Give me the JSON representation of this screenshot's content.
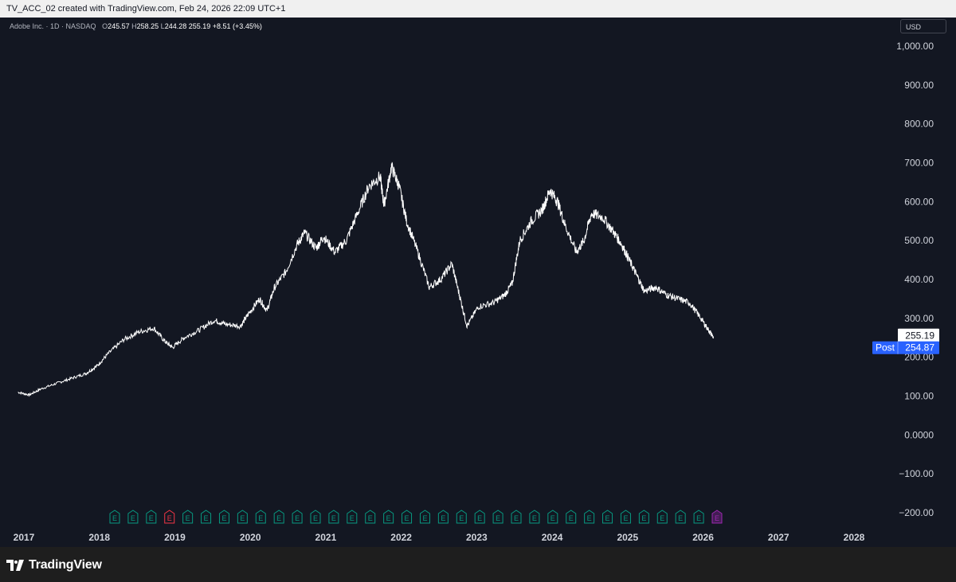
{
  "header": {
    "caption": "TV_ACC_02 created with TradingView.com, Feb 24, 2026 22:09 UTC+1"
  },
  "legend": {
    "symbol": "Adobe Inc. · 1D · NASDAQ",
    "open_label": "O",
    "open": "245.57",
    "high_label": "H",
    "high": "258.25",
    "low_label": "L",
    "low": "244.28",
    "close": "255.19",
    "change": "+8.51 (+3.45%)"
  },
  "currency_button": "USD",
  "price_badges": {
    "last": "255.19",
    "post_label": "Post",
    "post": "254.87"
  },
  "earnings": {
    "marker_label": "E",
    "count": 34,
    "last_color": "#9c27b0",
    "past_color": "#089981",
    "miss_color": "#f23645",
    "miss_index": 3
  },
  "brand": {
    "name": "TradingView",
    "icon": "tradingview-logo-icon"
  },
  "colors": {
    "background": "#131722",
    "line": "#ffffff",
    "axis_text": "#d1d4dc",
    "post_badge": "#2962ff"
  },
  "chart_data": {
    "type": "line",
    "title": "Adobe Inc. · 1D · NASDAQ",
    "xlabel": "",
    "ylabel": "",
    "x_ticks": [
      "2017",
      "2018",
      "2019",
      "2020",
      "2021",
      "2022",
      "2023",
      "2024",
      "2025",
      "2026",
      "2027",
      "2028"
    ],
    "y_ticks": [
      "1,000.00",
      "900.00",
      "800.00",
      "700.00",
      "600.00",
      "500.00",
      "400.00",
      "300.00",
      "200.00",
      "100.00",
      "0.0000",
      "−100.00",
      "−200.00"
    ],
    "ylim": [
      -200,
      1000
    ],
    "xlim": [
      2017.0,
      2028.0
    ],
    "series": [
      {
        "x": [
          2016.9,
          2017.05,
          2017.2,
          2017.4,
          2017.6,
          2017.8,
          2017.95,
          2018.1,
          2018.3,
          2018.5,
          2018.7,
          2018.85,
          2018.95,
          2019.1,
          2019.3,
          2019.5,
          2019.65,
          2019.85,
          2019.95,
          2020.1,
          2020.2,
          2020.3,
          2020.45,
          2020.6,
          2020.7,
          2020.85,
          2020.95,
          2021.1,
          2021.25,
          2021.4,
          2021.55,
          2021.7,
          2021.75,
          2021.85,
          2021.95,
          2022.05,
          2022.2,
          2022.35,
          2022.5,
          2022.65,
          2022.75,
          2022.85,
          2023.0,
          2023.2,
          2023.35,
          2023.45,
          2023.55,
          2023.7,
          2023.85,
          2023.95,
          2024.05,
          2024.15,
          2024.3,
          2024.4,
          2024.5,
          2024.65,
          2024.8,
          2024.9,
          2025.0,
          2025.1,
          2025.2,
          2025.35,
          2025.5,
          2025.65,
          2025.8,
          2025.95,
          2026.05,
          2026.12
        ],
        "y": [
          110,
          103,
          118,
          132,
          145,
          158,
          178,
          210,
          245,
          265,
          275,
          240,
          225,
          250,
          270,
          295,
          285,
          280,
          310,
          350,
          320,
          380,
          420,
          490,
          520,
          480,
          510,
          470,
          500,
          570,
          640,
          665,
          590,
          690,
          640,
          550,
          470,
          380,
          400,
          440,
          360,
          280,
          330,
          340,
          360,
          390,
          500,
          550,
          580,
          630,
          600,
          540,
          470,
          500,
          570,
          560,
          520,
          490,
          450,
          410,
          370,
          380,
          360,
          350,
          340,
          300,
          270,
          250
        ]
      }
    ]
  }
}
